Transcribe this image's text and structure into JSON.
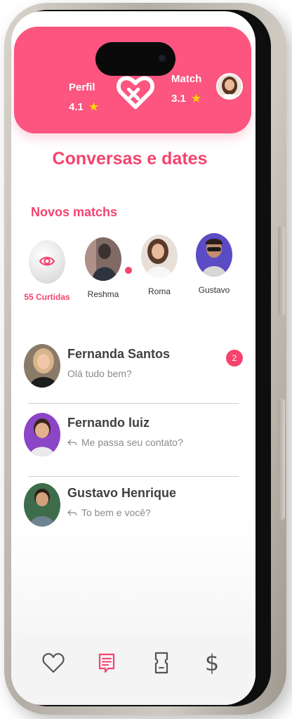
{
  "header": {
    "profile": {
      "label": "Perfil",
      "rating": "4.1"
    },
    "match": {
      "label": "Match",
      "rating": "3.1"
    },
    "icons": [
      "heart-logo-icon",
      "star-icon",
      "avatar"
    ]
  },
  "page_title": "Conversas e dates",
  "new_matches": {
    "title": "Novos matchs",
    "items": [
      {
        "label": "55 Curtidas",
        "icon": "eye-icon"
      },
      {
        "label": "Reshma"
      },
      {
        "label": "Roma"
      },
      {
        "label": "Gustavo"
      }
    ]
  },
  "chats": [
    {
      "name": "Fernanda Santos",
      "message": "Olá tudo bem?",
      "unread": "2"
    },
    {
      "name": "Fernando luiz",
      "message": "Me passa seu contato?"
    },
    {
      "name": "Gustavo  Henrique",
      "message": "To bem e você?"
    }
  ],
  "nav": {
    "items": [
      "heart-icon",
      "chat-icon",
      "ticket-icon",
      "dollar-icon"
    ],
    "dollar_symbol": "$",
    "active": "chat-icon"
  },
  "colors": {
    "accent": "#fb5580",
    "accent_text": "#f4446e",
    "star": "#ffd400",
    "nav_inactive": "#555555"
  }
}
